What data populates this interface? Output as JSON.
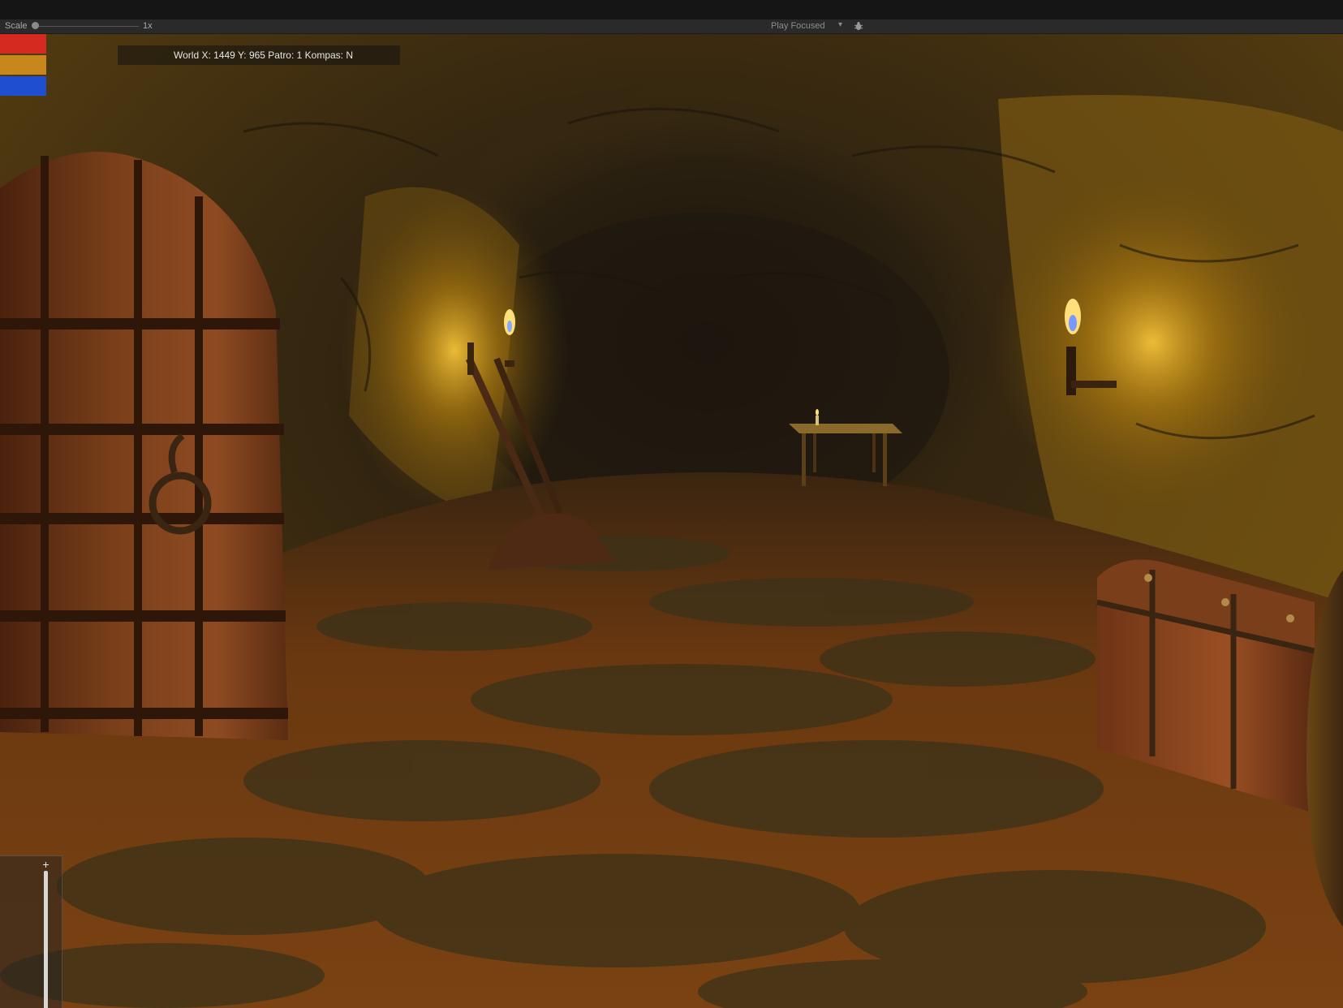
{
  "toolbar": {
    "scale_label": "Scale",
    "scale_value": "1x",
    "play_mode": "Play Focused",
    "play_mode_caret": "▾",
    "debug_icon": "bug-icon"
  },
  "hud": {
    "coords": "World X: 1449 Y: 965 Patro: 1 Kompas: N",
    "status_bars": [
      {
        "name": "health",
        "color": "#d42a20"
      },
      {
        "name": "stamina",
        "color": "#c8871c"
      },
      {
        "name": "mana",
        "color": "#1f4fd0"
      }
    ],
    "zoom": {
      "plus": "+",
      "minus": "+"
    }
  },
  "scene": {
    "description_icons": [
      "door-icon",
      "torch-icon",
      "torch-icon",
      "table-icon",
      "chest-icon",
      "barrel-icon",
      "lever-icon"
    ],
    "colors": {
      "rock_lit": "#8a6210",
      "rock_dark": "#2a1f10",
      "floor": "#6e3a10",
      "flame": "#ffd070"
    }
  }
}
